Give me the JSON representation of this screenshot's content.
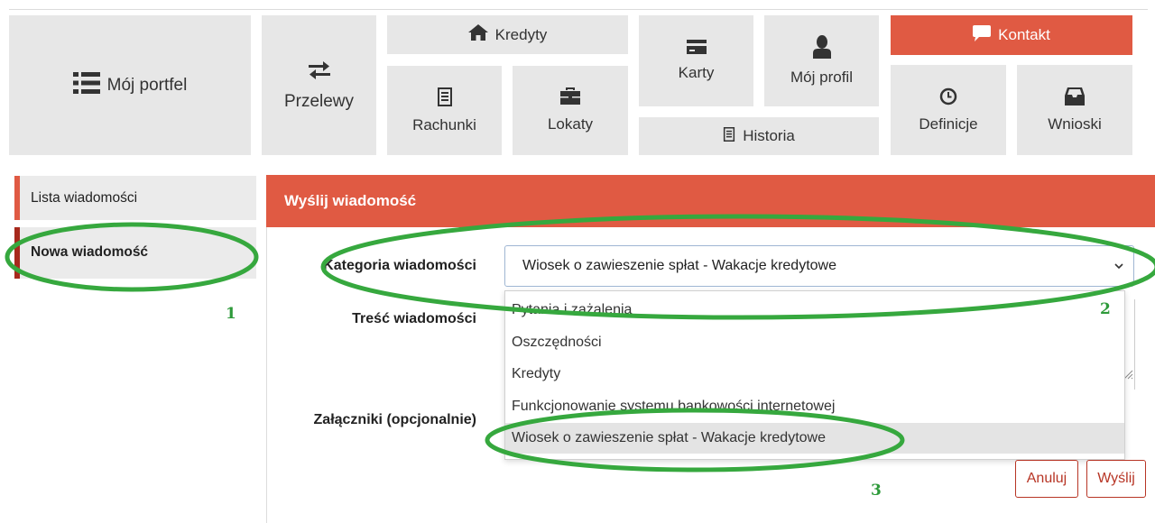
{
  "nav": {
    "portfel": "Mój portfel",
    "przelewy": "Przelewy",
    "kredyty": "Kredyty",
    "rachunki": "Rachunki",
    "lokaty": "Lokaty",
    "karty": "Karty",
    "profil": "Mój profil",
    "historia": "Historia",
    "kontakt": "Kontakt",
    "definicje": "Definicje",
    "wnioski": "Wnioski"
  },
  "sidebar": {
    "items": [
      {
        "label": "Lista wiadomości"
      },
      {
        "label": "Nowa wiadomość"
      }
    ]
  },
  "form": {
    "header": "Wyślij wiadomość",
    "category_label": "Kategoria wiadomości",
    "category_value": "Wiosek o zawieszenie spłat - Wakacje kredytowe",
    "content_label": "Treść wiadomości",
    "attachments_label": "Załączniki (opcjonalnie)",
    "options": [
      "Pytania i zażalenia",
      "Oszczędności",
      "Kredyty",
      "Funkcjonowanie systemu bankowości internetowej",
      "Wiosek o zawieszenie spłat - Wakacje kredytowe"
    ],
    "cancel_label": "Anuluj",
    "send_label": "Wyślij"
  },
  "annotations": [
    "1",
    "2",
    "3"
  ],
  "colors": {
    "accent": "#e05a43",
    "accent_dark": "#a7291c",
    "tile_bg": "#e7e7e7",
    "annotation_green": "#2e9a3a"
  }
}
